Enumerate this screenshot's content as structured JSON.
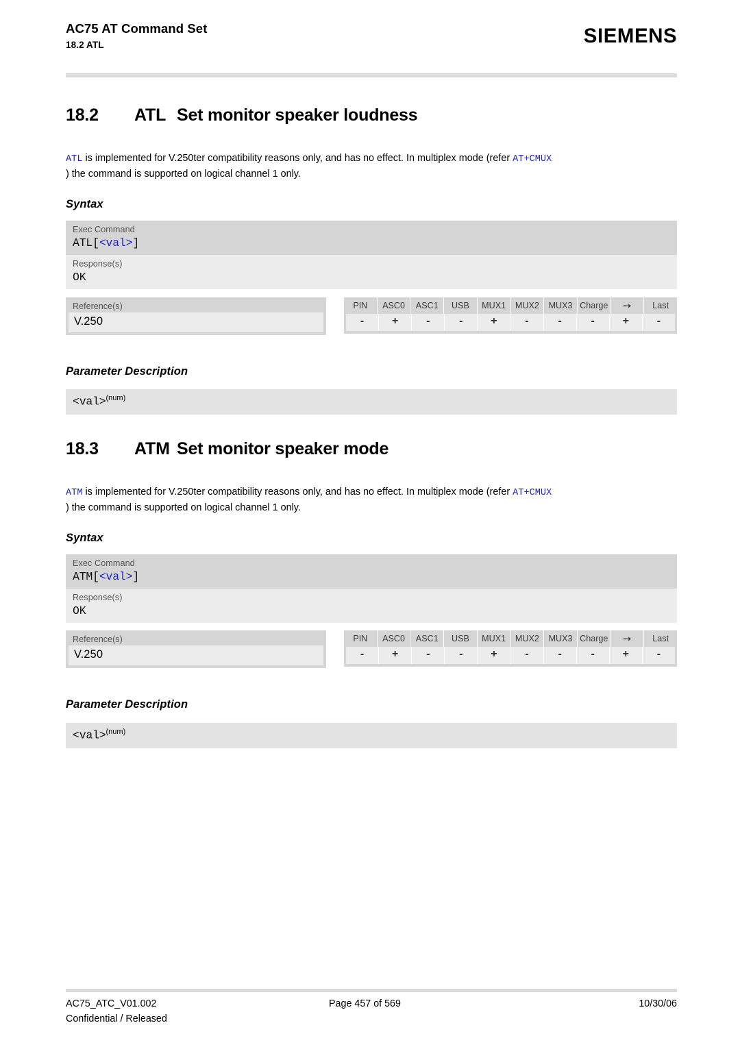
{
  "header": {
    "doc_title": "AC75 AT Command Set",
    "doc_subtitle": "18.2 ATL",
    "brand": "SIEMENS"
  },
  "sections": [
    {
      "number": "18.2",
      "command": "ATL",
      "title": "Set monitor speaker loudness",
      "intro": {
        "cmd_ref": "ATL",
        "text_1": " is implemented for V.250ter compatibility reasons only, and has no effect. In multiplex mode (refer ",
        "cmux_ref": "AT+CMUX",
        "text_2": ") the command is supported on logical channel 1 only."
      },
      "syntax_heading": "Syntax",
      "syntax": {
        "exec_label": "Exec Command",
        "exec_value_prefix": "ATL[",
        "exec_value_param": "<val>",
        "exec_value_suffix": "]",
        "response_label": "Response(s)",
        "response_value": "OK"
      },
      "references": {
        "label": "Reference(s)",
        "value": "V.250",
        "columns": [
          "PIN",
          "ASC0",
          "ASC1",
          "USB",
          "MUX1",
          "MUX2",
          "MUX3",
          "Charge",
          "airplane-icon",
          "Last"
        ],
        "values": [
          "-",
          "+",
          "-",
          "-",
          "+",
          "-",
          "-",
          "-",
          "+",
          "-"
        ]
      },
      "param_heading": "Parameter Description",
      "param": {
        "name": "<val>",
        "sup": "(num)"
      }
    },
    {
      "number": "18.3",
      "command": "ATM",
      "title": "Set monitor speaker mode",
      "intro": {
        "cmd_ref": "ATM",
        "text_1": " is implemented for V.250ter compatibility reasons only, and has no effect. In multiplex mode (refer ",
        "cmux_ref": "AT+CMUX",
        "text_2": ") the command is supported on logical channel 1 only."
      },
      "syntax_heading": "Syntax",
      "syntax": {
        "exec_label": "Exec Command",
        "exec_value_prefix": "ATM[",
        "exec_value_param": "<val>",
        "exec_value_suffix": "]",
        "response_label": "Response(s)",
        "response_value": "OK"
      },
      "references": {
        "label": "Reference(s)",
        "value": "V.250",
        "columns": [
          "PIN",
          "ASC0",
          "ASC1",
          "USB",
          "MUX1",
          "MUX2",
          "MUX3",
          "Charge",
          "airplane-icon",
          "Last"
        ],
        "values": [
          "-",
          "+",
          "-",
          "-",
          "+",
          "-",
          "-",
          "-",
          "+",
          "-"
        ]
      },
      "param_heading": "Parameter Description",
      "param": {
        "name": "<val>",
        "sup": "(num)"
      }
    }
  ],
  "footer": {
    "doc_id": "AC75_ATC_V01.002",
    "classification": "Confidential / Released",
    "page": "Page 457 of 569",
    "date": "10/30/06"
  },
  "colors": {
    "link": "#2222cc",
    "band_dark": "#d5d5d5",
    "band_light": "#ececec",
    "band_param": "#e3e3e3",
    "rule": "#dcdcdc"
  }
}
